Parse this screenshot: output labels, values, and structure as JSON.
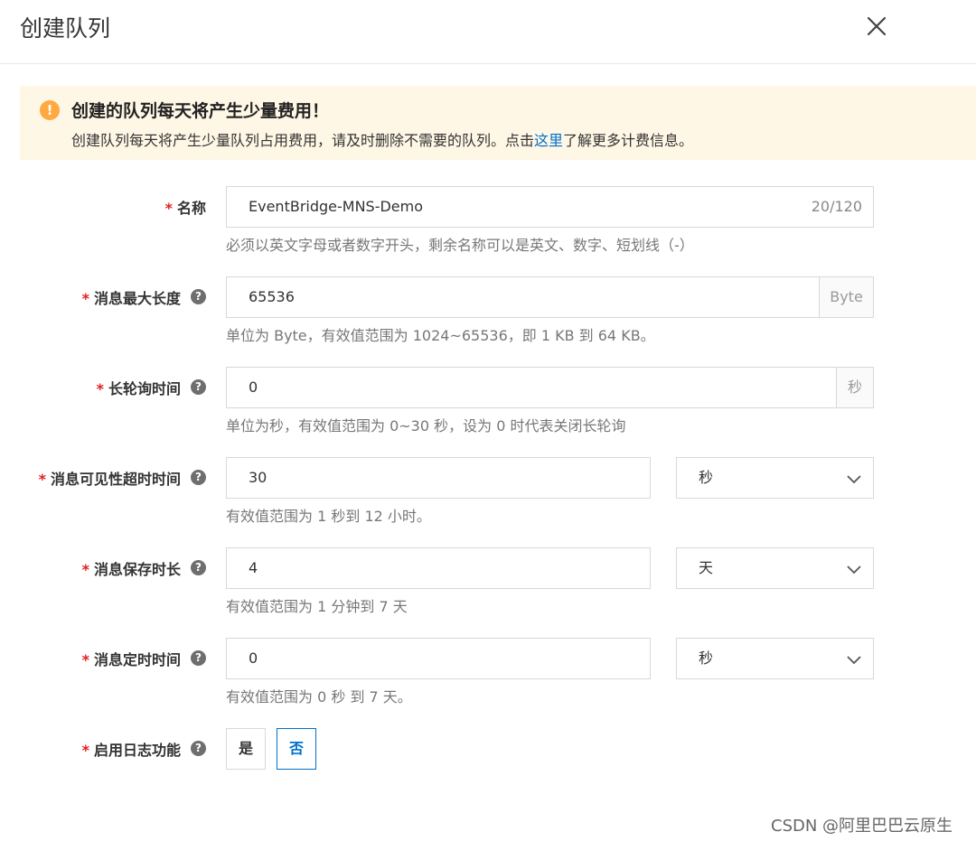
{
  "header": {
    "title": "创建队列"
  },
  "alert": {
    "title": "创建的队列每天将产生少量费用！",
    "desc_before": "创建队列每天将产生少量队列占用费用，请及时删除不需要的队列。点击",
    "link": "这里",
    "desc_after": "了解更多计费信息。"
  },
  "form": {
    "required_mark": "*",
    "help_glyph": "?",
    "name": {
      "label": "名称",
      "value": "EventBridge-MNS-Demo",
      "counter": "20/120",
      "hint": "必须以英文字母或者数字开头，剩余名称可以是英文、数字、短划线（-）"
    },
    "max_message_size": {
      "label": "消息最大长度",
      "value": "65536",
      "unit": "Byte",
      "hint": "单位为 Byte，有效值范围为 1024~65536，即 1 KB 到 64 KB。"
    },
    "long_polling": {
      "label": "长轮询时间",
      "value": "0",
      "unit": "秒",
      "hint": "单位为秒，有效值范围为 0~30 秒，设为 0 时代表关闭长轮询"
    },
    "visibility_timeout": {
      "label": "消息可见性超时时间",
      "value": "30",
      "unit": "秒",
      "hint": "有效值范围为 1 秒到 12 小时。"
    },
    "retention": {
      "label": "消息保存时长",
      "value": "4",
      "unit": "天",
      "hint": "有效值范围为 1 分钟到 7 天"
    },
    "delay": {
      "label": "消息定时时间",
      "value": "0",
      "unit": "秒",
      "hint": "有效值范围为 0 秒 到 7 天。"
    },
    "logging": {
      "label": "启用日志功能",
      "yes": "是",
      "no": "否",
      "selected": "否"
    }
  },
  "watermark": "CSDN @阿里巴巴云原生",
  "colors": {
    "accent": "#0070cc",
    "required": "#e02020",
    "alert_bg": "#fff7e6",
    "warn_icon": "#ffa940"
  }
}
